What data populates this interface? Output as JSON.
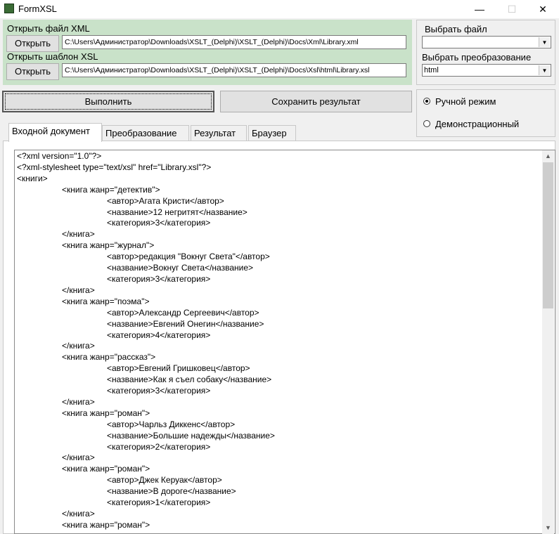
{
  "window": {
    "title": "FormXSL",
    "controls": {
      "minimize": "—",
      "maximize": "☐",
      "close": "✕"
    }
  },
  "open_xml": {
    "label": "Открыть файл XML",
    "button": "Открыть",
    "path": "C:\\Users\\Администратор\\Downloads\\XSLT_(Delphi)\\XSLT_(Delphi)\\Docs\\Xml\\Library.xml"
  },
  "open_xsl": {
    "label": "Открыть шаблон XSL",
    "button": "Открыть",
    "path": "C:\\Users\\Администратор\\Downloads\\XSLT_(Delphi)\\XSLT_(Delphi)\\Docs\\Xsl\\html\\Library.xsl"
  },
  "choose_file": {
    "label": "Выбрать файл",
    "value": ""
  },
  "choose_transform": {
    "label": "Выбрать преобразование",
    "value": "html"
  },
  "actions": {
    "execute": "Выполнить",
    "save": "Сохранить результат"
  },
  "mode": {
    "manual": "Ручной режим",
    "demo": "Демонстрационный",
    "selected": "manual"
  },
  "tabs": [
    "Входной документ",
    "Преобразование",
    "Результат",
    "Браузер"
  ],
  "active_tab": 0,
  "document_lines": [
    "<?xml version=\"1.0\"?>",
    "<?xml-stylesheet type=\"text/xsl\" href=\"Library.xsl\"?>",
    "<книги>",
    "\t\t<книга жанр=\"детектив\">",
    "\t\t\t\t<автор>Агата Кристи</автор>",
    "\t\t\t\t<название>12 негритят</название>",
    "\t\t\t\t<категория>3</категория>",
    "\t\t</книга>",
    "\t\t<книга жанр=\"журнал\">",
    "\t\t\t\t<автор>редакция \"Вокнуг Света\"</автор>",
    "\t\t\t\t<название>Вокнуг Света</название>",
    "\t\t\t\t<категория>3</категория>",
    "\t\t</книга>",
    "\t\t<книга жанр=\"поэма\">",
    "\t\t\t\t<автор>Александр Сергеевич</автор>",
    "\t\t\t\t<название>Евгений Онегин</название>",
    "\t\t\t\t<категория>4</категория>",
    "\t\t</книга>",
    "\t\t<книга жанр=\"рассказ\">",
    "\t\t\t\t<автор>Евгений Гришковец</автор>",
    "\t\t\t\t<название>Как я съел собаку</название>",
    "\t\t\t\t<категория>3</категория>",
    "\t\t</книга>",
    "\t\t<книга жанр=\"роман\">",
    "\t\t\t\t<автор>Чарльз Диккенс</автор>",
    "\t\t\t\t<название>Большие надежды</название>",
    "\t\t\t\t<категория>2</категория>",
    "\t\t</книга>",
    "\t\t<книга жанр=\"роман\">",
    "\t\t\t\t<автор>Джек Керуак</автор>",
    "\t\t\t\t<название>В дороге</название>",
    "\t\t\t\t<категория>1</категория>",
    "\t\t</книга>",
    "\t\t<книга жанр=\"роман\">"
  ]
}
